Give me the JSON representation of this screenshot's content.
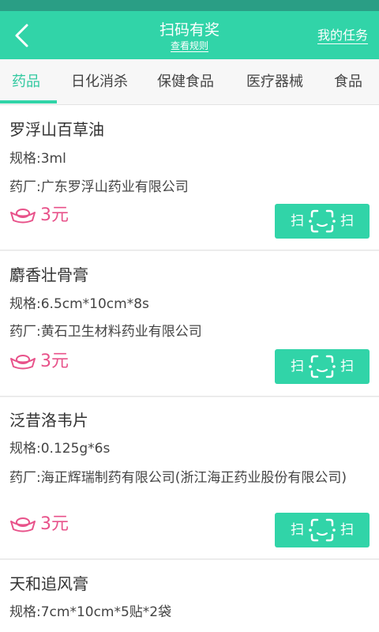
{
  "header": {
    "title": "扫码有奖",
    "subtitle": "查看规则",
    "right_link": "我的任务"
  },
  "tabs": [
    {
      "label": "药品",
      "active": true
    },
    {
      "label": "日化消杀",
      "active": false
    },
    {
      "label": "保健食品",
      "active": false
    },
    {
      "label": "医疗器械",
      "active": false
    },
    {
      "label": "食品",
      "active": false
    }
  ],
  "items": [
    {
      "name": "罗浮山百草油",
      "spec": "规格:3ml",
      "maker": "药厂:广东罗浮山药业有限公司",
      "reward": "3元",
      "scan_left": "扫",
      "scan_right": "扫"
    },
    {
      "name": "麝香壮骨膏",
      "spec": "规格:6.5cm*10cm*8s",
      "maker": "药厂:黄石卫生材料药业有限公司",
      "reward": "3元",
      "scan_left": "扫",
      "scan_right": "扫"
    },
    {
      "name": "泛昔洛韦片",
      "spec": "规格:0.125g*6s",
      "maker": "药厂:海正辉瑞制药有限公司(浙江海正药业股份有限公司)",
      "reward": "3元",
      "scan_left": "扫",
      "scan_right": "扫"
    },
    {
      "name": "天和追风膏",
      "spec": "规格:7cm*10cm*5贴*2袋",
      "maker": "",
      "reward": "",
      "scan_left": "",
      "scan_right": ""
    }
  ],
  "colors": {
    "accent": "#31d4a8",
    "reward": "#e8528a"
  }
}
